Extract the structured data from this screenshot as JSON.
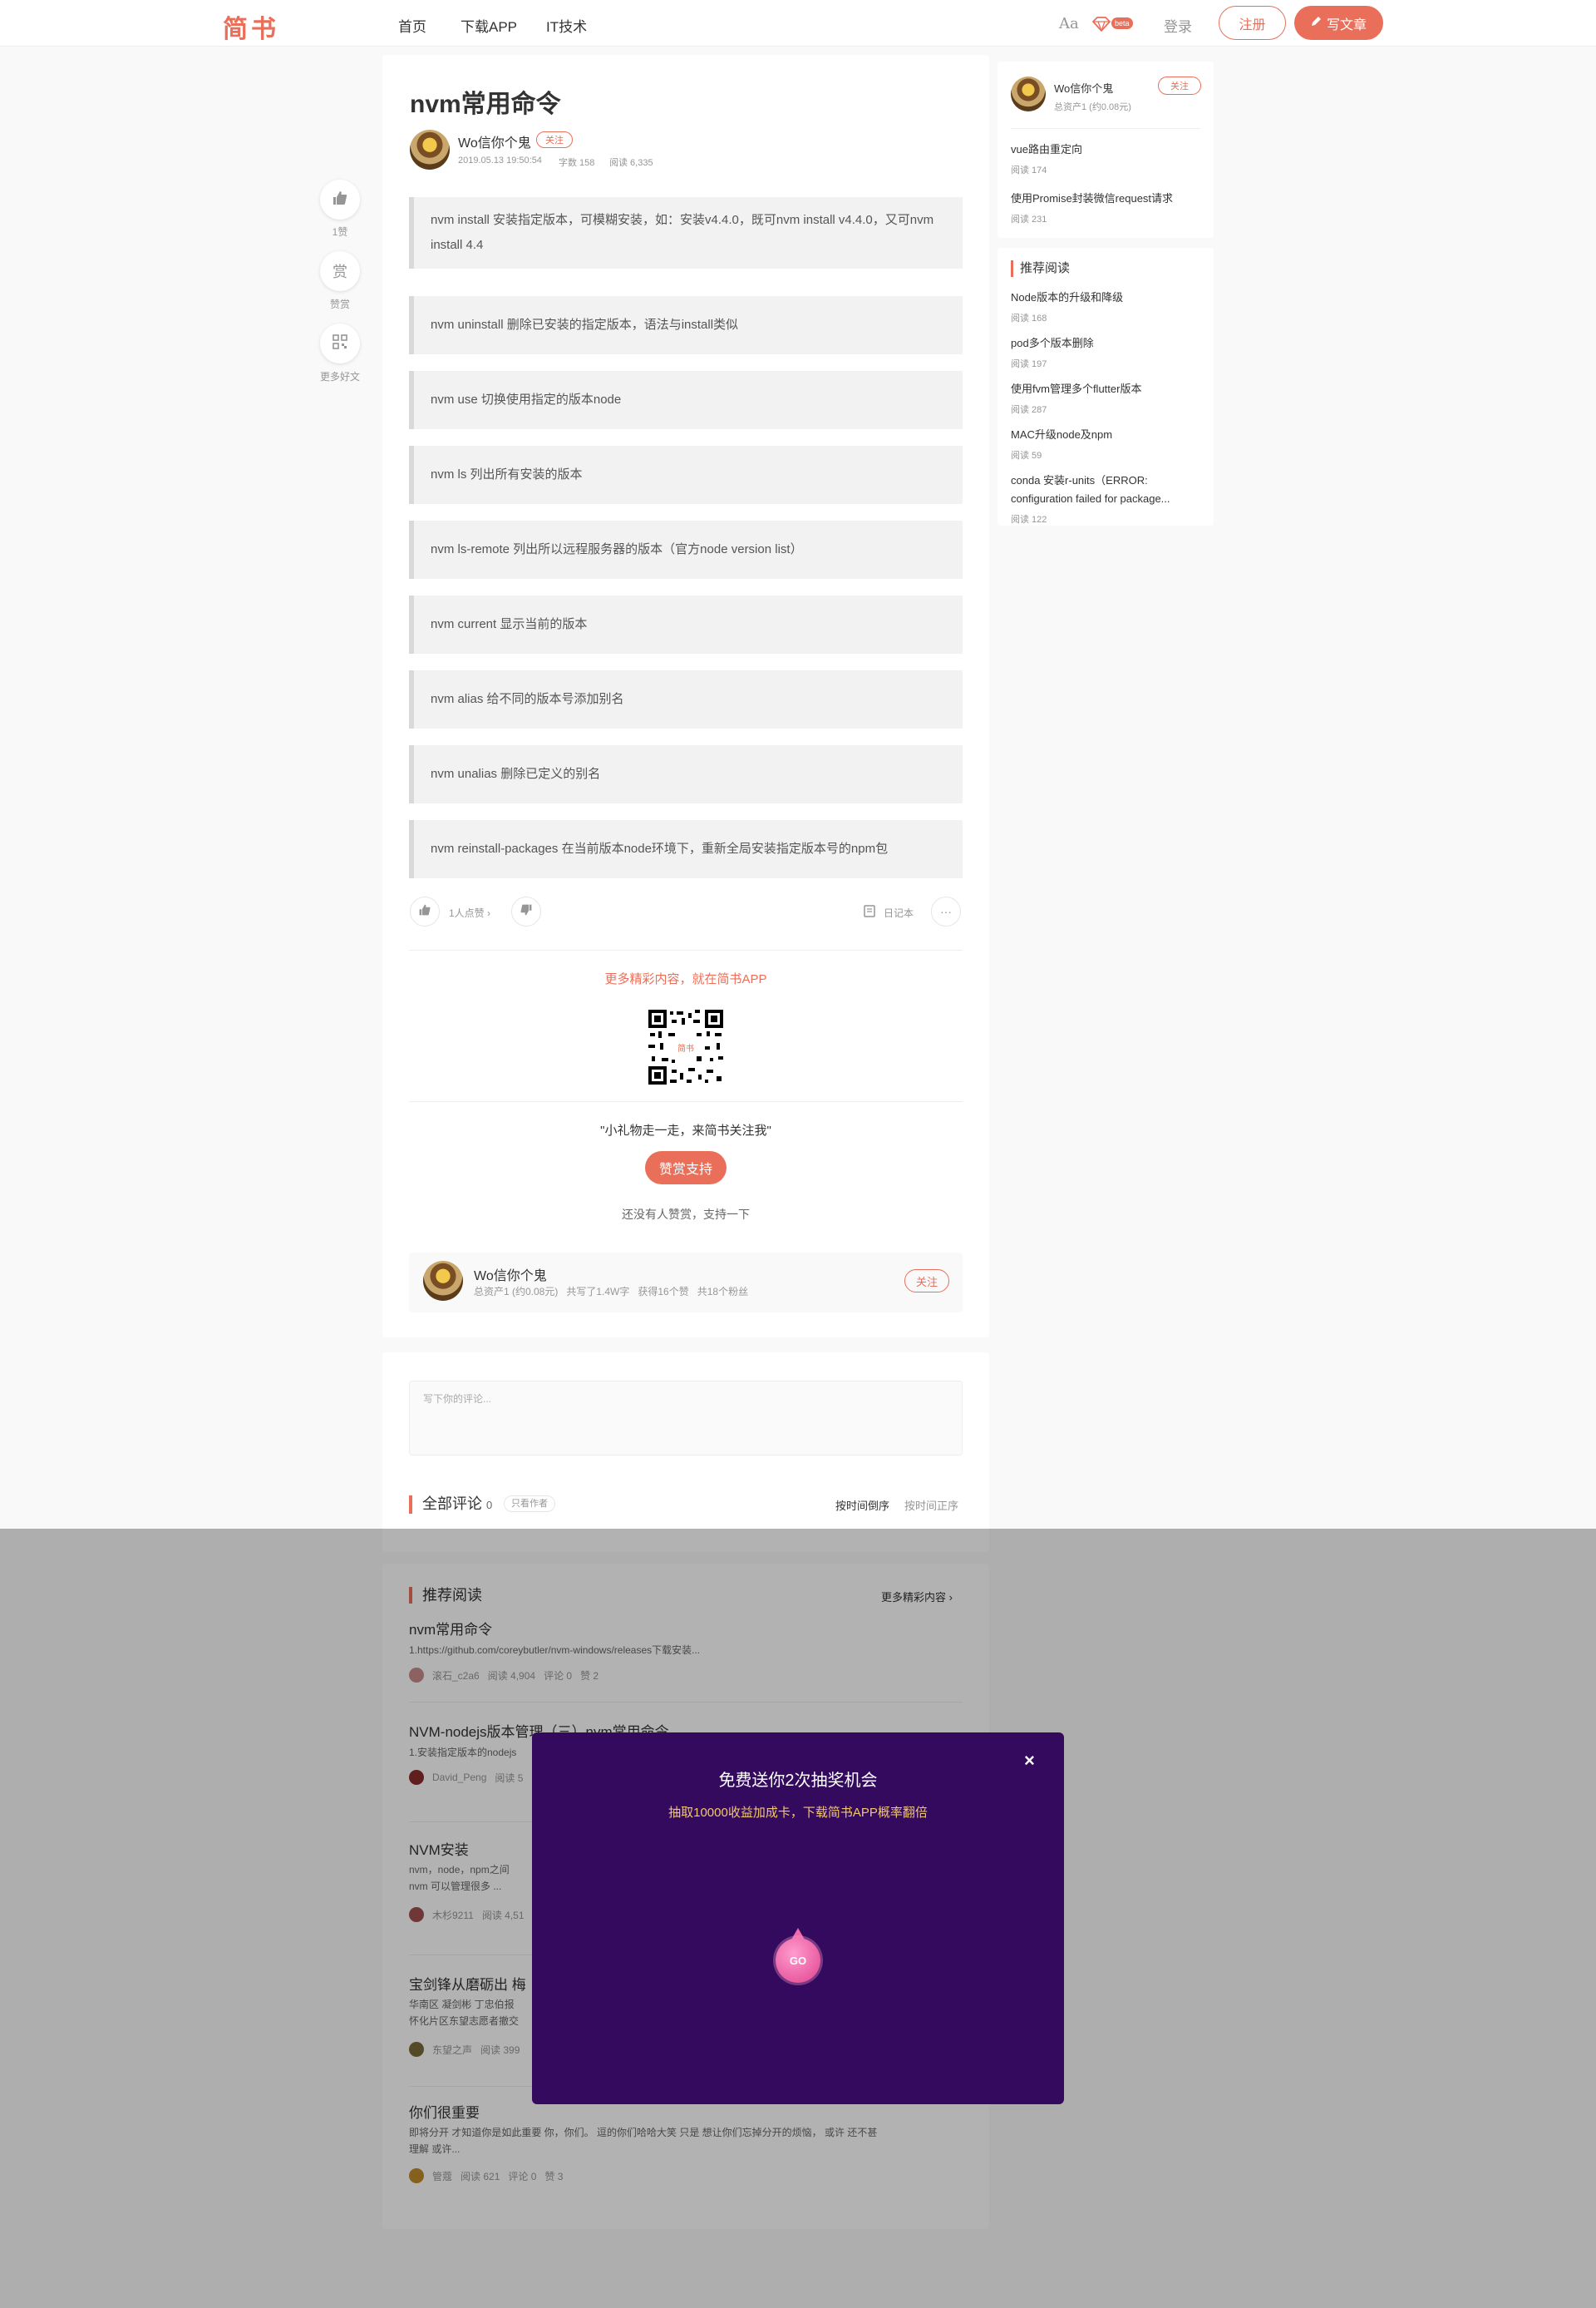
{
  "header": {
    "logo": "简书",
    "nav": [
      "首页",
      "下载APP",
      "IT技术"
    ],
    "font_toggle": "Aa",
    "beta": "beta",
    "login": "登录",
    "register": "注册",
    "write": "写文章"
  },
  "article": {
    "title": "nvm常用命令",
    "author": "Wo信你个鬼",
    "follow": "关注",
    "date": "2019.05.13 19:50:54",
    "words": "字数 158",
    "reads": "阅读 6,335",
    "quotes": [
      "nvm install 安装指定版本，可模糊安装，如：安装v4.4.0，既可nvm install v4.4.0，又可nvm install 4.4",
      "nvm uninstall 删除已安装的指定版本，语法与install类似",
      "nvm use 切换使用指定的版本node",
      "nvm ls 列出所有安装的版本",
      "nvm ls-remote 列出所以远程服务器的版本（官方node version list）",
      "nvm current 显示当前的版本",
      "nvm alias 给不同的版本号添加别名",
      "nvm unalias 删除已定义的别名",
      "nvm reinstall-packages 在当前版本node环境下，重新全局安装指定版本号的npm包"
    ],
    "like_text": "1人点赞",
    "notebook": "日记本",
    "more_app": "更多精彩内容，就在简书APP",
    "qr_label": "简书",
    "gift_text": "\"小礼物走一走，来简书关注我\"",
    "reward_btn": "赞赏支持",
    "no_reward": "还没有人赞赏，支持一下",
    "author_box": {
      "name": "Wo信你个鬼",
      "stats": "总资产1 (约0.08元)   共写了1.4W字   获得16个赞   共18个粉丝",
      "follow": "关注"
    }
  },
  "side_actions": {
    "like_count": "1赞",
    "reward_icon": "赏",
    "reward": "赞赏",
    "more": "更多好文"
  },
  "comments": {
    "placeholder": "写下你的评论...",
    "heading": "全部评论",
    "count": "0",
    "only_author": "只看作者",
    "sort_desc": "按时间倒序",
    "sort_asc": "按时间正序"
  },
  "recommend": {
    "heading": "推荐阅读",
    "more": "更多精彩内容",
    "items": [
      {
        "title": "nvm常用命令",
        "excerpt": "1.https://github.com/coreybutler/nvm-windows/releases下载安装...",
        "meta": [
          "滚石_c2a6",
          "阅读 4,904",
          "评论 0",
          "赞 2"
        ]
      },
      {
        "title": "NVM-nodejs版本管理（三）nvm常用命令",
        "excerpt": "1.安装指定版本的nodejs",
        "meta": [
          "David_Peng",
          "阅读 5"
        ]
      },
      {
        "title": "NVM安装",
        "excerpt": "nvm，node，npm之间",
        "excerpt2": "nvm 可以管理很多 ...",
        "meta": [
          "木杉9211",
          "阅读 4,51"
        ]
      },
      {
        "title": "宝剑锋从磨砺出 梅",
        "excerpt": "华南区 凝剑彬 丁忠伯报",
        "excerpt2": "怀化片区东望志愿者撤交",
        "meta": [
          "东望之声",
          "阅读 399"
        ]
      },
      {
        "title": "你们很重要",
        "excerpt": "即将分开 才知道你是如此重要 你，你们。 逗的你们哈哈大笑 只是 想让你们忘掉分开的烦恼， 或许 还不甚",
        "excerpt2": "理解 或许...",
        "meta": [
          "管蔻",
          "阅读 621",
          "评论 0",
          "赞 3"
        ]
      }
    ]
  },
  "sidebar": {
    "author": "Wo信你个鬼",
    "assets": "总资产1 (约0.08元)",
    "follow": "关注",
    "author_posts": [
      {
        "title": "vue路由重定向",
        "meta": "阅读 174"
      },
      {
        "title": "使用Promise封装微信request请求",
        "meta": "阅读 231"
      }
    ],
    "rec_heading": "推荐阅读",
    "rec_items": [
      {
        "title": "Node版本的升级和降级",
        "meta": "阅读 168"
      },
      {
        "title": "pod多个版本删除",
        "meta": "阅读 197"
      },
      {
        "title": "使用fvm管理多个flutter版本",
        "meta": "阅读 287"
      },
      {
        "title": "MAC升级node及npm",
        "meta": "阅读 59"
      },
      {
        "title": "conda 安装r-units（ERROR: configuration failed for package...",
        "meta": "阅读 122"
      }
    ]
  },
  "modal": {
    "title": "免费送你2次抽奖机会",
    "subtitle": "抽取10000收益加成卡，下载简书APP概率翻倍",
    "close": "×",
    "go": "GO"
  },
  "colors": {
    "accent": "#ea6f5a",
    "modal_bg": "#330a5e",
    "modal_sub": "#f3c86a"
  }
}
